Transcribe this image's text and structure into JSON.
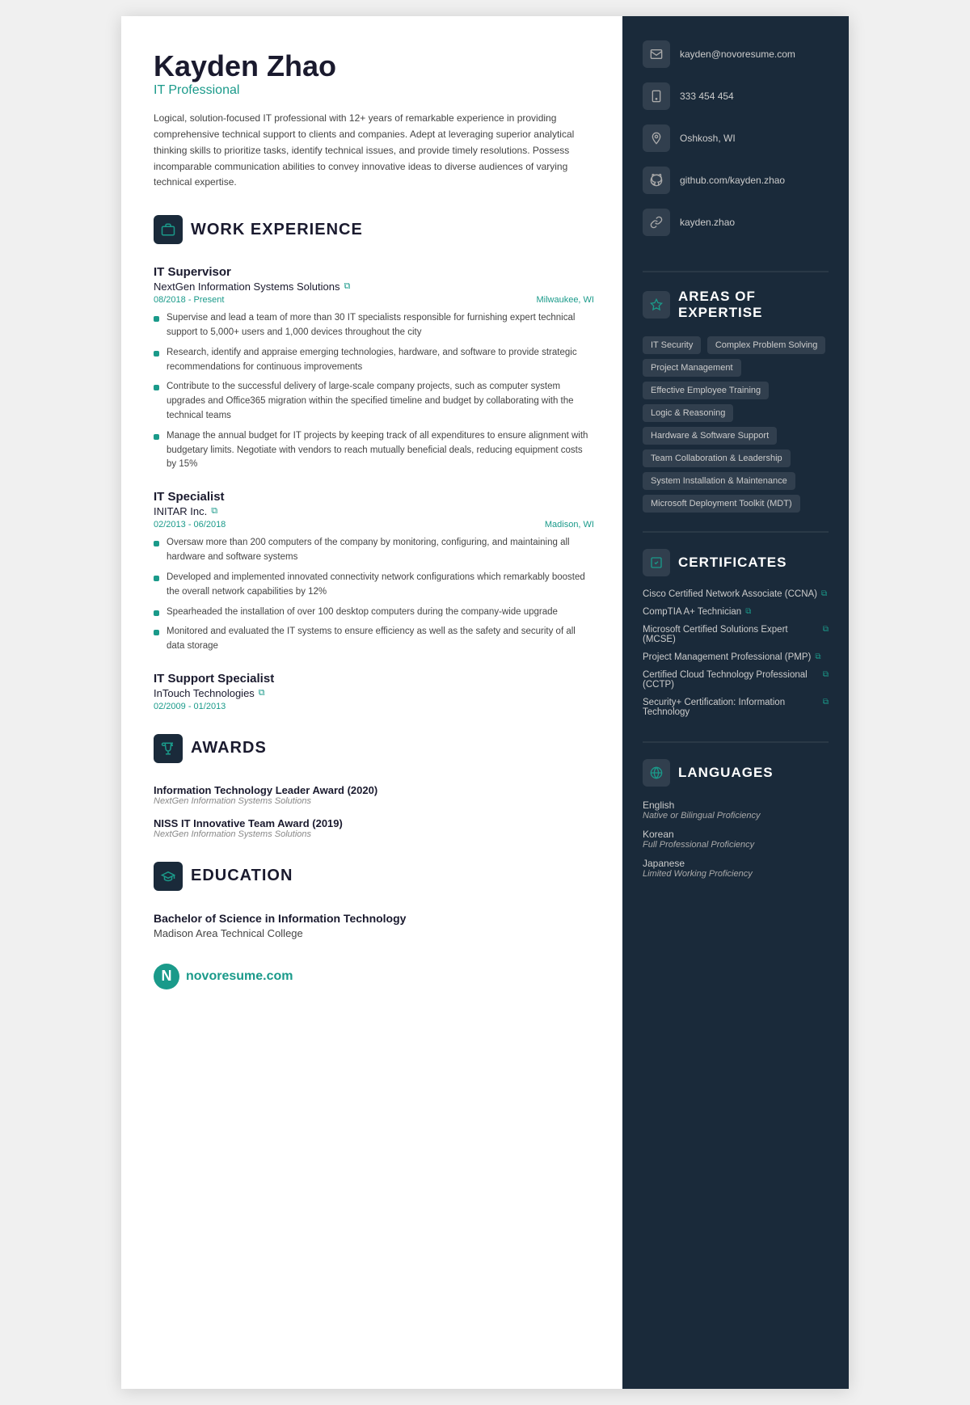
{
  "header": {
    "name": "Kayden Zhao",
    "title": "IT Professional",
    "summary": "Logical, solution-focused IT professional with 12+ years of remarkable experience in providing comprehensive technical support to clients and companies. Adept at leveraging superior analytical thinking skills to prioritize tasks, identify technical issues, and provide timely resolutions. Possess incomparable communication abilities to convey innovative ideas to diverse audiences of varying technical expertise."
  },
  "contact": {
    "email": "kayden@novoresume.com",
    "phone": "333 454 454",
    "location": "Oshkosh, WI",
    "github": "github.com/kayden.zhao",
    "portfolio": "kayden.zhao"
  },
  "sections": {
    "work_experience": "WORK EXPERIENCE",
    "awards": "AWARDS",
    "education": "EDUCATION",
    "areas_of_expertise": "AREAS OF EXPERTISE",
    "certificates": "CERTIFICATES",
    "languages": "LANGUAGES"
  },
  "jobs": [
    {
      "title": "IT Supervisor",
      "company": "NextGen Information Systems Solutions",
      "dates": "08/2018 - Present",
      "location": "Milwaukee, WI",
      "bullets": [
        "Supervise and lead a team of more than 30 IT specialists responsible for furnishing expert technical support to 5,000+ users and 1,000 devices throughout the city",
        "Research, identify and appraise emerging technologies, hardware, and software to provide strategic recommendations for continuous improvements",
        "Contribute to the successful delivery of large-scale company projects, such as computer system upgrades and Office365 migration within the specified timeline and budget by collaborating with the technical teams",
        "Manage the annual budget for IT projects by keeping track of all expenditures to ensure alignment with budgetary limits. Negotiate with vendors to reach mutually beneficial deals, reducing equipment costs by 15%"
      ]
    },
    {
      "title": "IT Specialist",
      "company": "INITAR Inc.",
      "dates": "02/2013 - 06/2018",
      "location": "Madison, WI",
      "bullets": [
        "Oversaw more than 200 computers of the company by monitoring, configuring, and maintaining all hardware and software systems",
        "Developed and implemented innovated connectivity network configurations which remarkably boosted the overall network capabilities by 12%",
        "Spearheaded the installation of over 100 desktop computers during the company-wide upgrade",
        "Monitored and evaluated the IT systems to ensure efficiency as well as the safety and security of all data storage"
      ]
    },
    {
      "title": "IT Support Specialist",
      "company": "InTouch Technologies",
      "dates": "02/2009 - 01/2013",
      "location": "",
      "bullets": []
    }
  ],
  "awards": [
    {
      "name": "Information Technology Leader Award (2020)",
      "org": "NextGen Information Systems Solutions"
    },
    {
      "name": "NISS IT Innovative Team Award (2019)",
      "org": "NextGen Information Systems Solutions"
    }
  ],
  "education": {
    "degree": "Bachelor of Science in Information Technology",
    "school": "Madison Area Technical College"
  },
  "skills": [
    "IT Security",
    "Complex Problem Solving",
    "Project Management",
    "Effective Employee Training",
    "Logic & Reasoning",
    "Hardware & Software Support",
    "Team Collaboration & Leadership",
    "System Installation & Maintenance",
    "Microsoft Deployment Toolkit (MDT)"
  ],
  "certificates": [
    "Cisco Certified Network Associate (CCNA)",
    "CompTIA A+ Technician",
    "Microsoft Certified Solutions Expert (MCSE)",
    "Project Management Professional (PMP)",
    "Certified Cloud Technology Professional (CCTP)",
    "Security+ Certification: Information Technology"
  ],
  "languages": [
    {
      "name": "English",
      "level": "Native or Bilingual Proficiency"
    },
    {
      "name": "Korean",
      "level": "Full Professional Proficiency"
    },
    {
      "name": "Japanese",
      "level": "Limited Working Proficiency"
    }
  ],
  "logo": {
    "text": "novoresume.com"
  }
}
